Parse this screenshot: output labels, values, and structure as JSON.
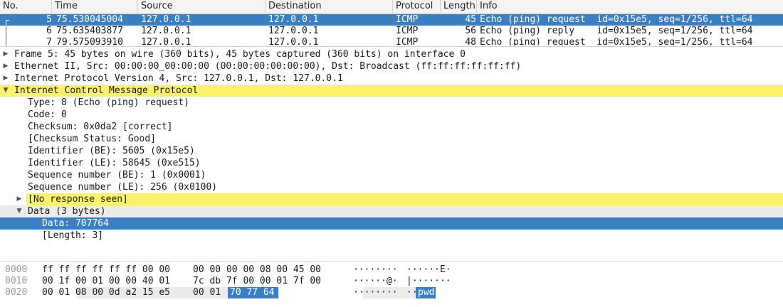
{
  "packet_list": {
    "columns": [
      "No.",
      "Time",
      "Source",
      "Destination",
      "Protocol",
      "Length",
      "Info"
    ],
    "rows": [
      {
        "no": "5",
        "time": "75.530045004",
        "source": "127.0.0.1",
        "destination": "127.0.0.1",
        "protocol": "ICMP",
        "length": "45",
        "info": "Echo (ping) request  id=0x15e5, seq=1/256, ttl=64",
        "selected": true
      },
      {
        "no": "6",
        "time": "75.635403877",
        "source": "127.0.0.1",
        "destination": "127.0.0.1",
        "protocol": "ICMP",
        "length": "56",
        "info": "Echo (ping) reply    id=0x15e5, seq=1/256, ttl=64",
        "selected": false
      },
      {
        "no": "7",
        "time": "79.575093910",
        "source": "127.0.0.1",
        "destination": "127.0.0.1",
        "protocol": "ICMP",
        "length": "48",
        "info": "Echo (ping) request  id=0x15e5, seq=1/256, ttl=64",
        "selected": false
      }
    ]
  },
  "details": {
    "frame": "Frame 5: 45 bytes on wire (360 bits), 45 bytes captured (360 bits) on interface 0",
    "ethernet": "Ethernet II, Src: 00:00:00_00:00:00 (00:00:00:00:00:00), Dst: Broadcast (ff:ff:ff:ff:ff:ff)",
    "ipv4": "Internet Protocol Version 4, Src: 127.0.0.1, Dst: 127.0.0.1",
    "icmp": "Internet Control Message Protocol",
    "icmp_fields": [
      "Type: 8 (Echo (ping) request)",
      "Code: 0",
      "Checksum: 0x0da2 [correct]",
      "[Checksum Status: Good]",
      "Identifier (BE): 5605 (0x15e5)",
      "Identifier (LE): 58645 (0xe515)",
      "Sequence number (BE): 1 (0x0001)",
      "Sequence number (LE): 256 (0x0100)"
    ],
    "no_response": "[No response seen]",
    "data": "Data (3 bytes)",
    "data_value": "Data: 707764",
    "data_length": "[Length: 3]"
  },
  "bytes": {
    "rows": [
      {
        "offset": "0000",
        "hex1": "ff ff ff ff ff ff 00 00",
        "hex2": "00 00 00 00 08 00 45 00",
        "ascii1": "········",
        "ascii2": "······E·"
      },
      {
        "offset": "0010",
        "hex1": "00 1f 00 01 00 00 40 01",
        "hex2": "7c db 7f 00 00 01 7f 00",
        "ascii1": "······@·",
        "ascii2": "|·······"
      },
      {
        "offset": "0020",
        "hex1": "00 01 08 00 0d a2 15 e5",
        "hex2": "00 01",
        "hex_sel": "70 77 64",
        "ascii1": "········",
        "ascii2": "··",
        "ascii_sel": "pwd"
      }
    ]
  },
  "colors": {
    "selection": "#3b7fc3",
    "highlight_yellow": "#fbf26c",
    "highlight_grey": "#ebebeb"
  }
}
